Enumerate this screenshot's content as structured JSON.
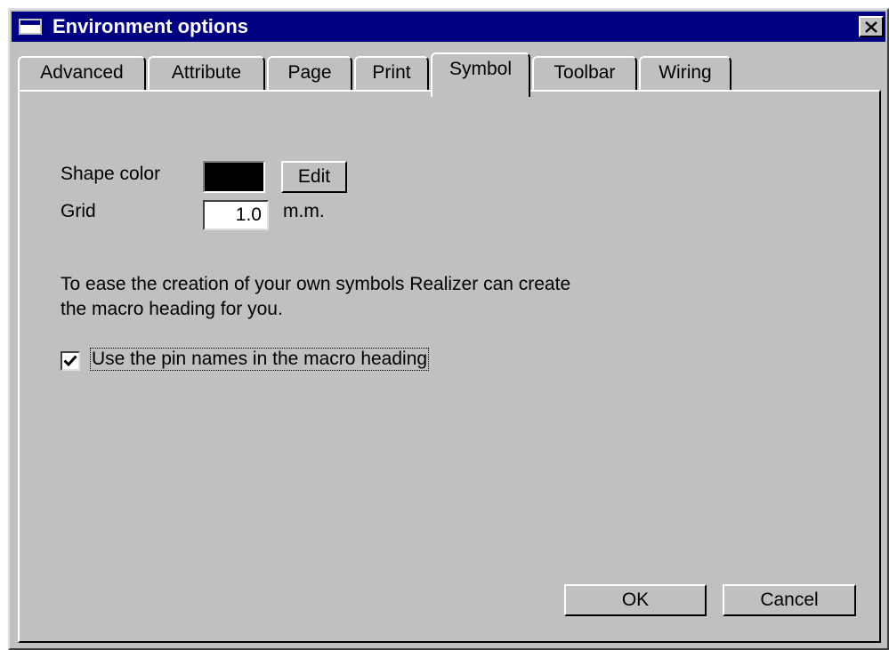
{
  "window": {
    "title": "Environment options",
    "close_glyph": "✕"
  },
  "tabs": [
    {
      "label": "Advanced",
      "active": false
    },
    {
      "label": "Attribute",
      "active": false
    },
    {
      "label": "Page",
      "active": false
    },
    {
      "label": "Print",
      "active": false
    },
    {
      "label": "Symbol",
      "active": true
    },
    {
      "label": "Toolbar",
      "active": false
    },
    {
      "label": "Wiring",
      "active": false
    }
  ],
  "symbol": {
    "shape_color_label": "Shape color",
    "shape_color_value": "#000000",
    "edit_label": "Edit",
    "grid_label": "Grid",
    "grid_value": "1.0",
    "grid_unit": "m.m.",
    "description_line1": "To ease the creation of your own symbols Realizer can create",
    "description_line2": "the macro heading for you.",
    "checkbox_label": "Use the pin names in the macro heading",
    "checkbox_checked": true
  },
  "footer": {
    "ok_label": "OK",
    "cancel_label": "Cancel"
  },
  "colors": {
    "titlebar": "#000080",
    "face": "#c0c0c0"
  }
}
